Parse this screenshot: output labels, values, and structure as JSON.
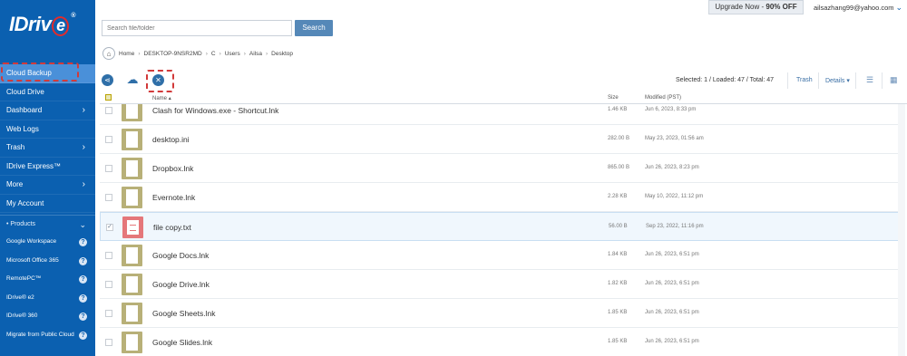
{
  "app": {
    "logo_text": "IDriv",
    "logo_e": "e",
    "logo_reg": "®"
  },
  "topbar": {
    "upgrade_prefix": "Upgrade Now - ",
    "upgrade_offer": "90% OFF",
    "user_email": "ailsazhang99@yahoo.com"
  },
  "search": {
    "placeholder": "Search file/folder",
    "button": "Search"
  },
  "breadcrumb": [
    "Home",
    "DESKTOP-9NSR2MD",
    "C",
    "Users",
    "Ailsa",
    "Desktop"
  ],
  "sidebar": {
    "items": [
      {
        "label": "Cloud Backup",
        "chevron": false
      },
      {
        "label": "Cloud Drive",
        "chevron": false
      },
      {
        "label": "Dashboard",
        "chevron": true
      },
      {
        "label": "Web Logs",
        "chevron": false
      },
      {
        "label": "Trash",
        "chevron": true
      },
      {
        "label": "IDrive Express™",
        "chevron": false
      },
      {
        "label": "More",
        "chevron": true
      },
      {
        "label": "My Account",
        "chevron": false
      }
    ],
    "products_label": "Products",
    "products": [
      {
        "label": "Google Workspace"
      },
      {
        "label": "Microsoft Office 365"
      },
      {
        "label": "RemotePC™"
      },
      {
        "label": "IDrive® e2"
      },
      {
        "label": "IDrive® 360"
      },
      {
        "label": "Migrate from Public Cloud"
      }
    ]
  },
  "toolbar": {
    "selected_info": "Selected: 1 / Loaded: 47 / Total: 47",
    "trash": "Trash",
    "details": "Details"
  },
  "table": {
    "columns": {
      "name": "Name",
      "size": "Size",
      "modified": "Modified (PST)"
    },
    "rows": [
      {
        "name": "Clash for Windows.exe - Shortcut.lnk",
        "size": "1.46 KB",
        "modified": "Jun 6, 2023, 8:33 pm",
        "type": "lnk",
        "checked": false
      },
      {
        "name": "desktop.ini",
        "size": "282.00 B",
        "modified": "May 23, 2023, 01:56 am",
        "type": "lnk",
        "checked": false
      },
      {
        "name": "Dropbox.lnk",
        "size": "865.00 B",
        "modified": "Jun 26, 2023, 8:23 pm",
        "type": "lnk",
        "checked": false
      },
      {
        "name": "Evernote.lnk",
        "size": "2.28 KB",
        "modified": "May 10, 2022, 11:12 pm",
        "type": "lnk",
        "checked": false
      },
      {
        "name": "file copy.txt",
        "size": "56.00 B",
        "modified": "Sep 23, 2022, 11:16 pm",
        "type": "txt",
        "checked": true
      },
      {
        "name": "Google Docs.lnk",
        "size": "1.84 KB",
        "modified": "Jun 26, 2023, 6:51 pm",
        "type": "lnk",
        "checked": false
      },
      {
        "name": "Google Drive.lnk",
        "size": "1.82 KB",
        "modified": "Jun 26, 2023, 6:51 pm",
        "type": "lnk",
        "checked": false
      },
      {
        "name": "Google Sheets.lnk",
        "size": "1.85 KB",
        "modified": "Jun 26, 2023, 6:51 pm",
        "type": "lnk",
        "checked": false
      },
      {
        "name": "Google Slides.lnk",
        "size": "1.85 KB",
        "modified": "Jun 26, 2023, 6:51 pm",
        "type": "lnk",
        "checked": false
      }
    ]
  },
  "colors": {
    "sidebar": "#0b60b0",
    "active": "#4a90d9",
    "highlight": "#d23a3a",
    "accent": "#5588b8"
  }
}
